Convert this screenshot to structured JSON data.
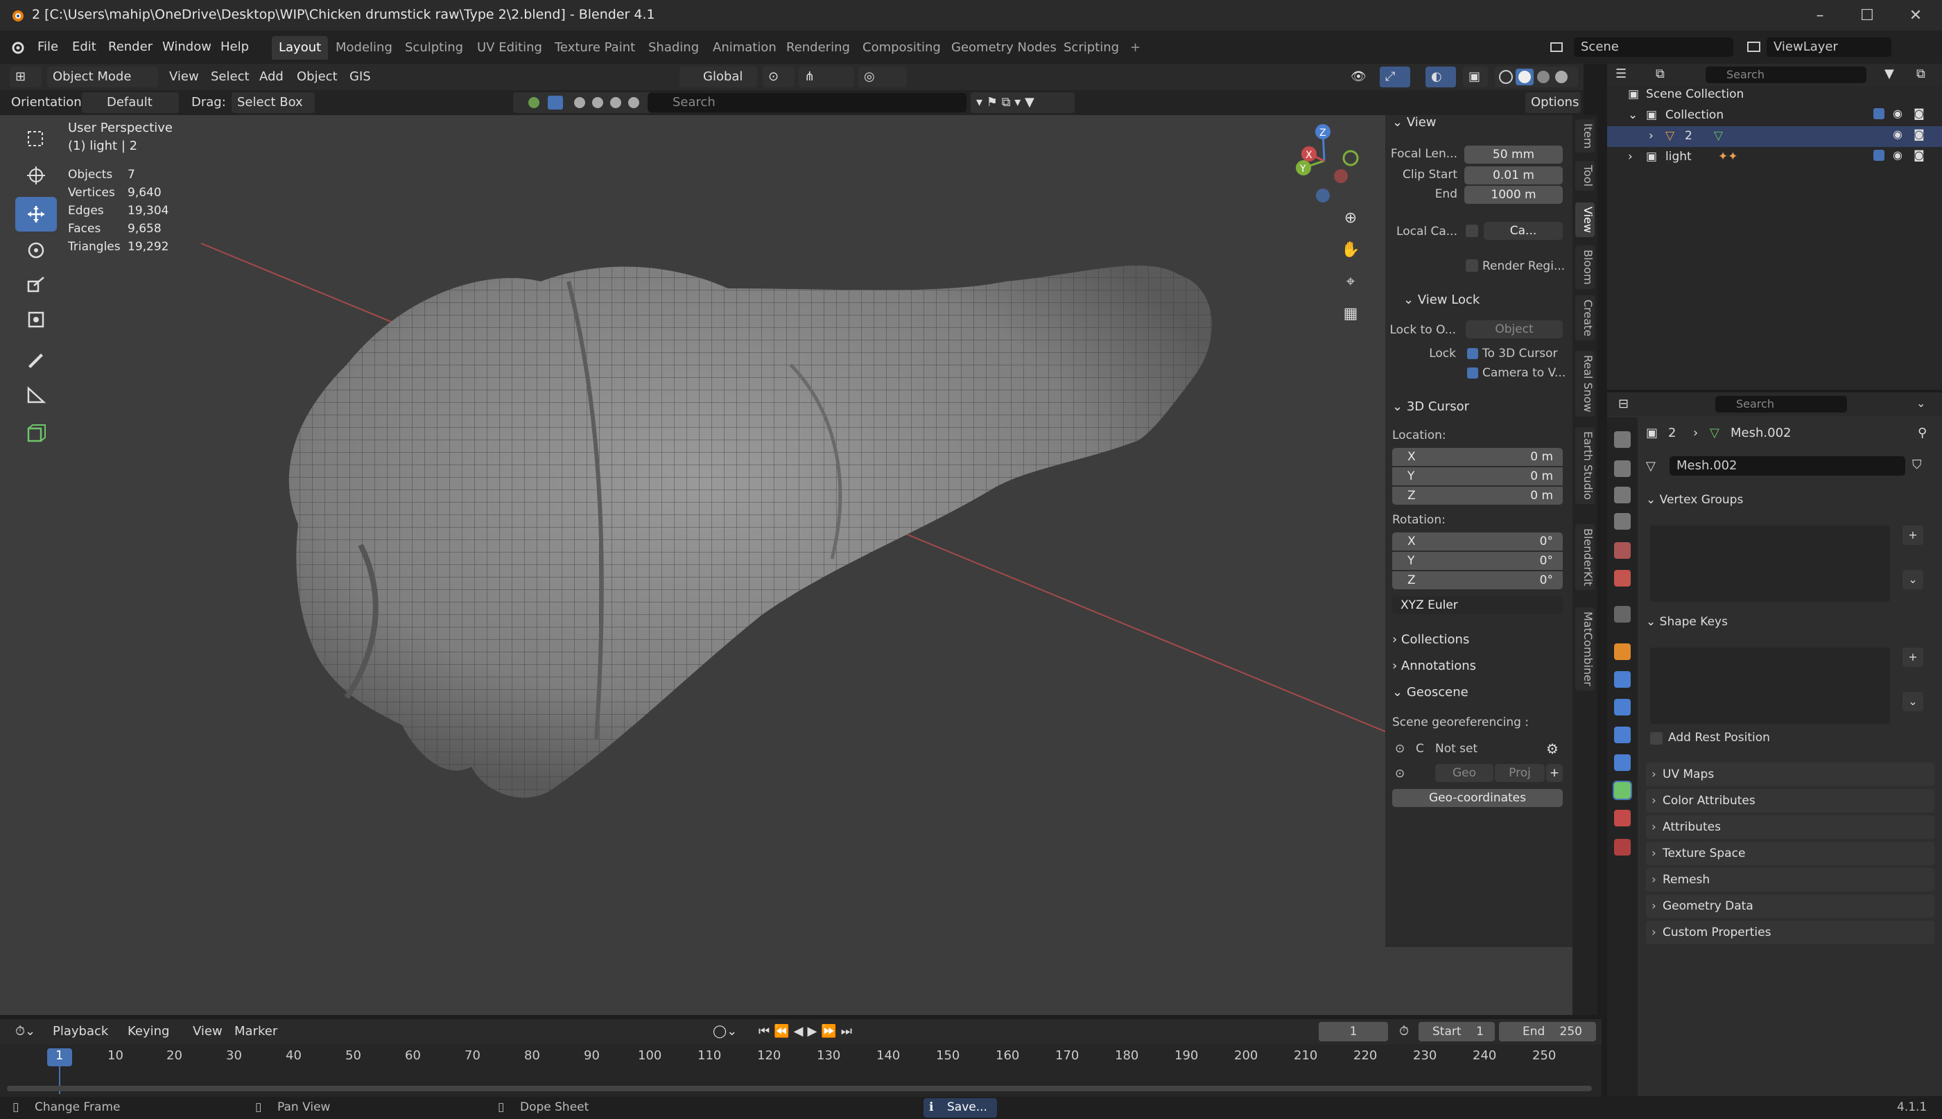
{
  "window": {
    "title": "2 [C:\\Users\\mahip\\OneDrive\\Desktop\\WIP\\Chicken drumstick raw\\Type 2\\2.blend] - Blender 4.1",
    "minimize": "–",
    "maximize": "☐",
    "close": "✕"
  },
  "menubar": {
    "items": [
      "File",
      "Edit",
      "Render",
      "Window",
      "Help"
    ],
    "workspaces": [
      "Layout",
      "Modeling",
      "Sculpting",
      "UV Editing",
      "Texture Paint",
      "Shading",
      "Animation",
      "Rendering",
      "Compositing",
      "Geometry Nodes",
      "Scripting"
    ],
    "add_tab": "+",
    "scene": "Scene",
    "view_layer": "ViewLayer"
  },
  "viewport_header": {
    "mode": "Object Mode",
    "menus": [
      "View",
      "Select",
      "Add",
      "Object",
      "GIS"
    ],
    "transform_orientation": "Global"
  },
  "tool_header": {
    "orientation_label": "Orientation:",
    "orientation": "Default",
    "drag_label": "Drag:",
    "drag": "Select Box",
    "search_placeholder": "Search",
    "options": "Options"
  },
  "viewport": {
    "perspective": "User Perspective",
    "object_info": "(1) light | 2",
    "stats": [
      {
        "label": "Objects",
        "value": "7"
      },
      {
        "label": "Vertices",
        "value": "9,640"
      },
      {
        "label": "Edges",
        "value": "19,304"
      },
      {
        "label": "Faces",
        "value": "9,658"
      },
      {
        "label": "Triangles",
        "value": "19,292"
      }
    ],
    "gizmo": {
      "x": "X",
      "y": "Y",
      "z": "Z"
    }
  },
  "npanel": {
    "view": {
      "title": "View",
      "focal_label": "Focal Len...",
      "focal": "50 mm",
      "clip_start_label": "Clip Start",
      "clip_start": "0.01 m",
      "end_label": "End",
      "end": "1000 m",
      "local_cam_label": "Local Ca...",
      "local_cam": "Ca...",
      "render_region": "Render Regi..."
    },
    "view_lock": {
      "title": "View Lock",
      "lock_to_label": "Lock to O...",
      "lock_to": "Object",
      "lock_label": "Lock",
      "to_cursor": "To 3D Cursor",
      "camera_to_view": "Camera to V..."
    },
    "cursor": {
      "title": "3D Cursor",
      "location_label": "Location:",
      "loc": [
        {
          "k": "X",
          "v": "0 m"
        },
        {
          "k": "Y",
          "v": "0 m"
        },
        {
          "k": "Z",
          "v": "0 m"
        }
      ],
      "rotation_label": "Rotation:",
      "rot": [
        {
          "k": "X",
          "v": "0°"
        },
        {
          "k": "Y",
          "v": "0°"
        },
        {
          "k": "Z",
          "v": "0°"
        }
      ],
      "rot_mode": "XYZ Euler"
    },
    "collections": "Collections",
    "annotations": "Annotations",
    "geoscene": {
      "title": "Geoscene",
      "georef_label": "Scene georeferencing :",
      "crs_prefix": "C",
      "crs": "Not set",
      "geo": "Geo",
      "proj": "Proj",
      "geo_coords": "Geo-coordinates"
    },
    "tabs": [
      "Item",
      "Tool",
      "View",
      "Bloom",
      "Create",
      "Real Snow",
      "Earth Studio",
      "BlenderKit",
      "MatCombiner"
    ]
  },
  "outliner": {
    "search_placeholder": "Search",
    "root": "Scene Collection",
    "collection": "Collection",
    "items": [
      "2",
      "light"
    ]
  },
  "properties": {
    "search_placeholder": "Search",
    "breadcrumb_obj": "2",
    "breadcrumb_mesh": "Mesh.002",
    "mesh_name": "Mesh.002",
    "vertex_groups": "Vertex Groups",
    "shape_keys": "Shape Keys",
    "add_rest_position": "Add Rest Position",
    "collapsed": [
      "UV Maps",
      "Color Attributes",
      "Attributes",
      "Texture Space",
      "Remesh",
      "Geometry Data",
      "Custom Properties"
    ]
  },
  "timeline": {
    "menus": [
      "Playback",
      "Keying",
      "View",
      "Marker"
    ],
    "current_frame": "1",
    "start_label": "Start",
    "start": "1",
    "end_label": "End",
    "end": "250",
    "ticks": [
      "1",
      "10",
      "20",
      "30",
      "40",
      "50",
      "60",
      "70",
      "80",
      "90",
      "100",
      "110",
      "120",
      "130",
      "140",
      "150",
      "160",
      "170",
      "180",
      "190",
      "200",
      "210",
      "220",
      "230",
      "240",
      "250"
    ]
  },
  "statusbar": {
    "change_frame": "Change Frame",
    "pan_view": "Pan View",
    "dope_sheet": "Dope Sheet",
    "saving": "Save...",
    "version": "4.1.1"
  },
  "colors": {
    "accent": "#4772b3",
    "viewport_bg": "#3d3d3d",
    "x_axis": "#c84b4b",
    "y_axis": "#7fb03b",
    "z_axis": "#4a7fd1"
  }
}
